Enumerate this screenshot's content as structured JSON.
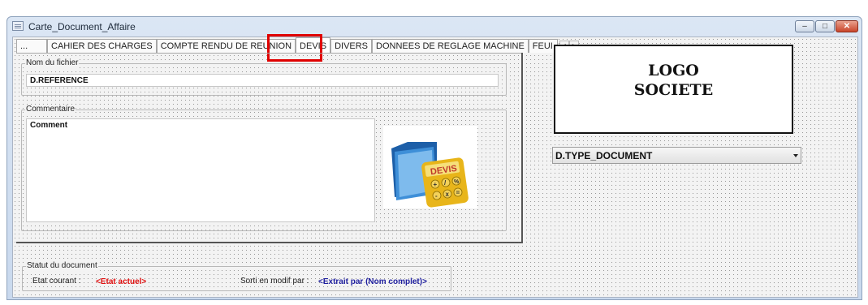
{
  "window": {
    "title": "Carte_Document_Affaire",
    "min_label": "–",
    "max_label": "□",
    "close_label": "✕"
  },
  "tabs": [
    {
      "label": "..."
    },
    {
      "label": "CAHIER DES CHARGES"
    },
    {
      "label": "COMPTE RENDU DE REUNION"
    },
    {
      "label": "DEVIS"
    },
    {
      "label": "DIVERS"
    },
    {
      "label": "DONNEES DE REGLAGE MACHINE"
    },
    {
      "label": "FEUI"
    }
  ],
  "tab_arrows": {
    "left": "◄",
    "right": "►"
  },
  "nom_fichier": {
    "label": "Nom du fichier",
    "value": "D.REFERENCE"
  },
  "commentaire": {
    "label": "Commentaire",
    "value": "Comment"
  },
  "devis_icon": {
    "badge": "DEVIS",
    "keys": [
      "+",
      "/",
      "%",
      "-",
      "x",
      "="
    ]
  },
  "logo": {
    "line1": "LOGO",
    "line2": "SOCIETE"
  },
  "type_document": {
    "value": "D.TYPE_DOCUMENT"
  },
  "statut": {
    "label": "Statut du document",
    "etat_label": "Etat courant :",
    "etat_value": "<Etat actuel>",
    "sorti_label": "Sorti en modif par :",
    "sorti_value": "<Extrait par (Nom complet)>"
  },
  "colors": {
    "highlight": "#e00000",
    "etat_value": "#e01010",
    "sorti_value": "#1f1f9f"
  }
}
